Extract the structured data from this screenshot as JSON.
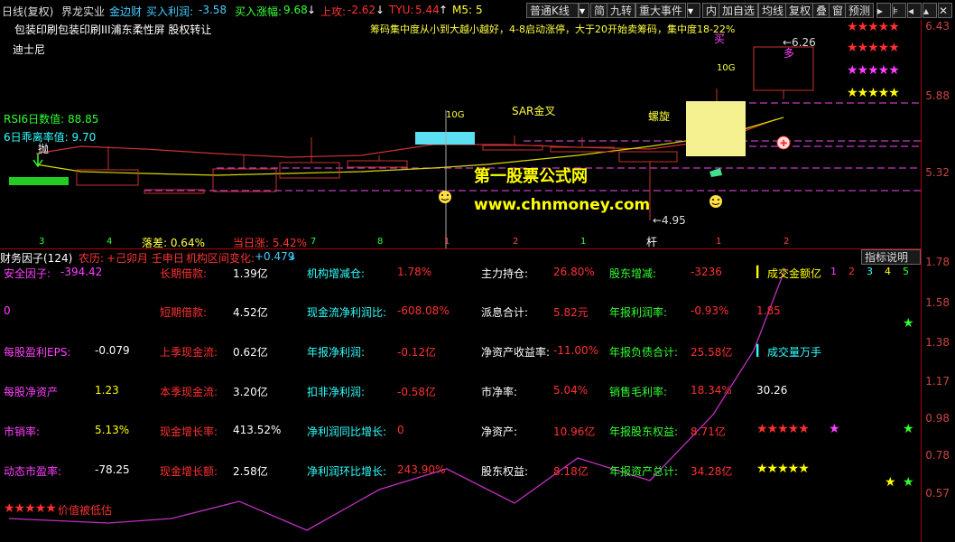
{
  "top_bar": {
    "period": "日线(复权)",
    "stock": "界龙实业",
    "jzc_label": "金边财",
    "buy_profit_label": "买入利润:",
    "buy_profit_val": "-3.58",
    "buy_rise_label": "买入涨幅:",
    "buy_rise_val": "9.68",
    "up_attack_label": "上攻:",
    "up_attack_val": "-2.62",
    "tyu_label": "TYU:",
    "tyu_val": "5.44",
    "m5_label": "M5:",
    "m5_val": "5",
    "buttons": [
      "普通K线",
      "简",
      "九转",
      "重大事件",
      "内",
      "加自选",
      "均线",
      "复权",
      "叠",
      "窗",
      "预测"
    ]
  },
  "chart_top": {
    "concepts": "包装印刷包装印刷III浦东柔性屏 股权转让",
    "chip_info": "筹码集中度从小到大越小越好，4-8启动涨停，大于20开始卖筹码，集中度18-22%",
    "disney": "迪士尼",
    "rsi6": "RSI6日数值: 88.85",
    "bias6": "6日乖离率值: 9.70",
    "pao": "抛",
    "sar": "SAR金叉",
    "luoxuan": "螺旋",
    "tag_10g_1": "10G",
    "tag_10g_2": "10G",
    "mai": "买",
    "duo": "多",
    "gan": "杆",
    "price_high": "←6.26",
    "price_low": "←4.95",
    "luocha": "落差: 0.64%",
    "dangri": "当日涨: 5.42%",
    "counts": [
      "3",
      "4",
      "7",
      "8",
      "1",
      "2",
      "1",
      "1",
      "2"
    ],
    "watermark1": "第一股票公式网",
    "watermark2": "www.chnmoney.com"
  },
  "axis_top": [
    "6.43",
    "5.88",
    "5.32"
  ],
  "axis_bottom": [
    "1.78",
    "1.58",
    "1.38",
    "1.17",
    "0.98",
    "0.78",
    "0.57"
  ],
  "lower_header": {
    "title": "财务因子(124)",
    "lunar_label": "农历:",
    "lunar_val": "+己卯月 壬申日",
    "inst_label": "机构区间变化:",
    "inst_val": "+0.479",
    "button": "指标说明"
  },
  "fin": {
    "r1": [
      "安全因子:",
      "-394.42",
      "长期借款:",
      "1.39亿",
      "机构增减仓:",
      "1.78%",
      "主力持仓:",
      "26.80%",
      "股东增减:",
      "-3236",
      "成交金额亿",
      "1",
      "2",
      "3",
      "4",
      "5"
    ],
    "r2": [
      "0",
      "短期借款:",
      "4.52亿",
      "现金流净利润比:",
      "-608.08%",
      "派息合计:",
      "5.82元",
      "年报利润率:",
      "-0.93%",
      "1.85"
    ],
    "r3": [
      "每股盈利EPS:",
      "-0.079",
      "上季现金流:",
      "0.62亿",
      "年报净利润:",
      "-0.12亿",
      "净资产收益率:",
      "-11.00%",
      "年报负债合计:",
      "25.58亿",
      "成交量万手"
    ],
    "r4": [
      "每股净资产",
      "1.23",
      "本季现金流:",
      "3.20亿",
      "扣非净利润:",
      "-0.58亿",
      "市净率:",
      "5.04%",
      "销售毛利率:",
      "18.34%",
      "30.26"
    ],
    "r5": [
      "市销率:",
      "5.13%",
      "现金增长率:",
      "413.52%",
      "净利润同比增长:",
      "0",
      "净资产:",
      "10.96亿",
      "年报股东权益:",
      "8.71亿"
    ],
    "r6": [
      "动态市盈率:",
      "-78.25",
      "现金增长额:",
      "2.58亿",
      "净利润环比增长:",
      "243.90%",
      "股东权益:",
      "8.18亿",
      "年报资产总计:",
      "34.28亿"
    ],
    "bottom": "价值被低估"
  },
  "colors": {
    "red": "#ff3030",
    "yellow": "#ffff00",
    "magenta": "#ff30ff",
    "cyan": "#30ffff",
    "green": "#30ff30",
    "white": "#e0e0e0"
  }
}
